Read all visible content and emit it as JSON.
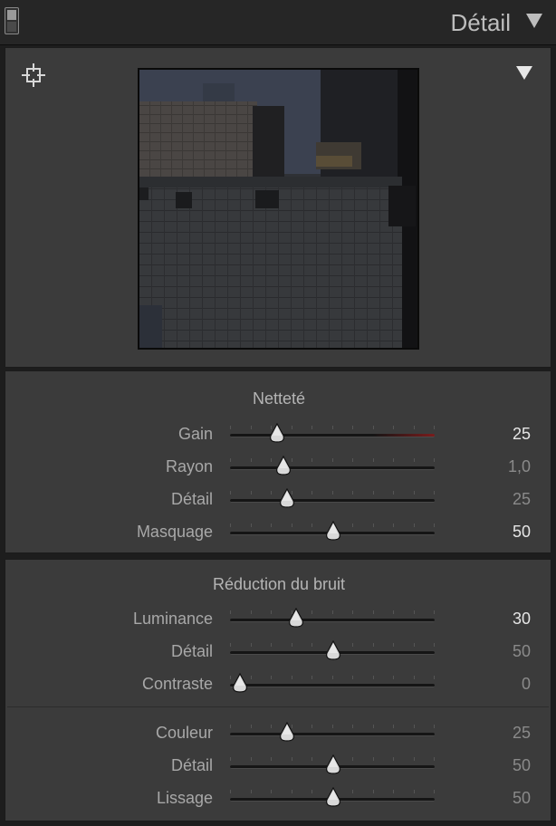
{
  "panel": {
    "title": "Détail",
    "icons": {
      "solo_switch": "panel-switch-icon",
      "collapse": "triangle-down-icon",
      "target": "crosshair-target-icon",
      "preview_menu": "triangle-down-icon"
    }
  },
  "sharpening": {
    "title": "Netteté",
    "sliders": [
      {
        "label": "Gain",
        "value": "25",
        "fraction": 0.2,
        "highlight": true,
        "track_red": true
      },
      {
        "label": "Rayon",
        "value": "1,0",
        "fraction": 0.233,
        "highlight": false,
        "track_red": false
      },
      {
        "label": "Détail",
        "value": "25",
        "fraction": 0.25,
        "highlight": false,
        "track_red": false
      },
      {
        "label": "Masquage",
        "value": "50",
        "fraction": 0.5,
        "highlight": true,
        "track_red": false
      }
    ]
  },
  "noise_reduction": {
    "title": "Réduction du bruit",
    "luminance_sliders": [
      {
        "label": "Luminance",
        "value": "30",
        "fraction": 0.3,
        "highlight": true,
        "track_red": false
      },
      {
        "label": "Détail",
        "value": "50",
        "fraction": 0.5,
        "highlight": false,
        "track_red": false
      },
      {
        "label": "Contraste",
        "value": "0",
        "fraction": 0.0,
        "highlight": false,
        "track_red": false
      }
    ],
    "color_sliders": [
      {
        "label": "Couleur",
        "value": "25",
        "fraction": 0.25,
        "highlight": false,
        "track_red": false
      },
      {
        "label": "Détail",
        "value": "50",
        "fraction": 0.5,
        "highlight": false,
        "track_red": false
      },
      {
        "label": "Lissage",
        "value": "50",
        "fraction": 0.5,
        "highlight": false,
        "track_red": false
      }
    ]
  },
  "colors": {
    "panel_bg": "#3b3b3b",
    "header_bg": "#262626",
    "value_bright": "#e6e6e6",
    "value_dim": "#8a8a8a",
    "gain_track_accent": "#7a1c1c"
  }
}
